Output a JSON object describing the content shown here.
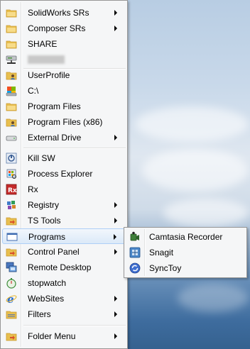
{
  "menu": {
    "items": [
      {
        "label": "SolidWorks SRs",
        "icon": "folder-icon",
        "submenu": true
      },
      {
        "label": "Composer SRs",
        "icon": "folder-icon",
        "submenu": true
      },
      {
        "label": "SHARE",
        "icon": "folder-icon",
        "submenu": false
      },
      {
        "label": "",
        "icon": "network-drive-icon",
        "submenu": false,
        "redacted": true
      },
      {
        "label": "UserProfile",
        "icon": "user-folder-icon",
        "submenu": false
      },
      {
        "label": "C:\\",
        "icon": "drive-c-icon",
        "submenu": false
      },
      {
        "label": "Program Files",
        "icon": "folder-icon",
        "submenu": false
      },
      {
        "label": "Program Files (x86)",
        "icon": "user-folder-icon",
        "submenu": false
      },
      {
        "label": "External Drive",
        "icon": "external-drive-icon",
        "submenu": true
      },
      {
        "label": "Kill SW",
        "icon": "kill-sw-icon",
        "submenu": false
      },
      {
        "label": "Process Explorer",
        "icon": "process-explorer-icon",
        "submenu": false
      },
      {
        "label": "Rx",
        "icon": "rx-icon",
        "submenu": false
      },
      {
        "label": "Registry",
        "icon": "registry-icon",
        "submenu": true
      },
      {
        "label": "TS Tools",
        "icon": "folder-arrow-icon",
        "submenu": true
      },
      {
        "label": "Programs",
        "icon": "programs-icon",
        "submenu": true,
        "active": true
      },
      {
        "label": "Control Panel",
        "icon": "folder-arrow-icon",
        "submenu": true
      },
      {
        "label": "Remote Desktop",
        "icon": "remote-desktop-icon",
        "submenu": false
      },
      {
        "label": "stopwatch",
        "icon": "stopwatch-icon",
        "submenu": false
      },
      {
        "label": "WebSites",
        "icon": "ie-icon",
        "submenu": true
      },
      {
        "label": "Filters",
        "icon": "filters-icon",
        "submenu": true
      },
      {
        "label": "Folder Menu",
        "icon": "folder-arrow-icon",
        "submenu": true
      }
    ]
  },
  "programs_submenu": {
    "items": [
      {
        "label": "Camtasia Recorder",
        "icon": "camtasia-icon"
      },
      {
        "label": "Snagit",
        "icon": "snagit-icon"
      },
      {
        "label": "SyncToy",
        "icon": "synctoy-icon"
      }
    ]
  },
  "colors": {
    "menu_bg": "#f5f6f7",
    "menu_border": "#979797",
    "highlight_border": "#aecff7",
    "folder": "#e2b33f"
  }
}
